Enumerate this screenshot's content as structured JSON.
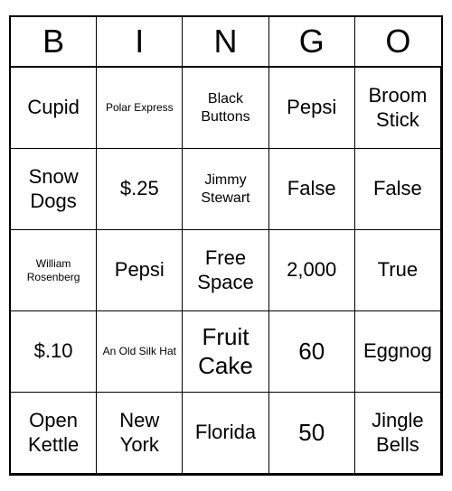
{
  "header": {
    "letters": [
      "B",
      "I",
      "N",
      "G",
      "O"
    ]
  },
  "cells": [
    {
      "text": "Cupid",
      "size": "large"
    },
    {
      "text": "Polar Express",
      "size": "small"
    },
    {
      "text": "Black Buttons",
      "size": "normal"
    },
    {
      "text": "Pepsi",
      "size": "large"
    },
    {
      "text": "Broom Stick",
      "size": "large"
    },
    {
      "text": "Snow Dogs",
      "size": "large"
    },
    {
      "text": "$.25",
      "size": "large"
    },
    {
      "text": "Jimmy Stewart",
      "size": "normal"
    },
    {
      "text": "False",
      "size": "large"
    },
    {
      "text": "False",
      "size": "large"
    },
    {
      "text": "William Rosenberg",
      "size": "small"
    },
    {
      "text": "Pepsi",
      "size": "large"
    },
    {
      "text": "Free Space",
      "size": "large"
    },
    {
      "text": "2,000",
      "size": "large"
    },
    {
      "text": "True",
      "size": "large"
    },
    {
      "text": "$.10",
      "size": "large"
    },
    {
      "text": "An Old Silk Hat",
      "size": "small"
    },
    {
      "text": "Fruit Cake",
      "size": "xlarge"
    },
    {
      "text": "60",
      "size": "xlarge"
    },
    {
      "text": "Eggnog",
      "size": "large"
    },
    {
      "text": "Open Kettle",
      "size": "large"
    },
    {
      "text": "New York",
      "size": "large"
    },
    {
      "text": "Florida",
      "size": "large"
    },
    {
      "text": "50",
      "size": "xlarge"
    },
    {
      "text": "Jingle Bells",
      "size": "large"
    }
  ]
}
